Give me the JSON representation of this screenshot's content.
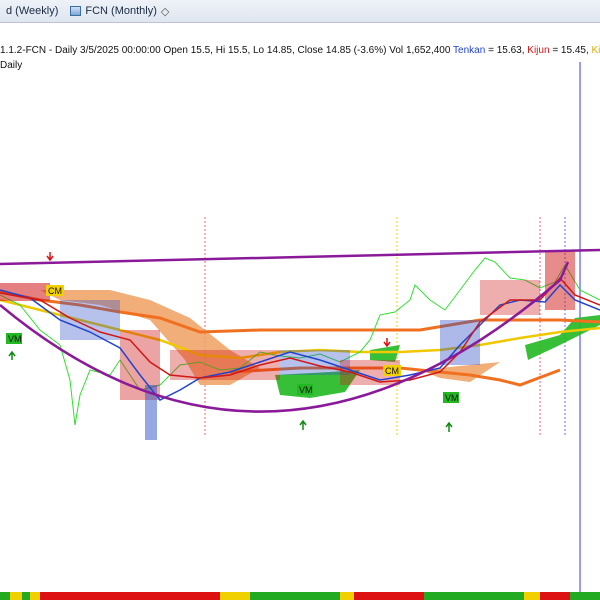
{
  "tabs": [
    {
      "label": "d (Weekly)"
    },
    {
      "label": "FCN (Monthly)"
    }
  ],
  "pin_glyph": "◇",
  "info": {
    "series_id": "1.1.2-FCN",
    "period": "Daily",
    "datetime": "3/5/2025 00:00:00",
    "open_label": "Open",
    "open": "15.5",
    "high_label": "Hi",
    "high": "15.5",
    "low_label": "Lo",
    "low": "14.85",
    "close_label": "Close",
    "close": "14.85",
    "change": "(-3.6%)",
    "vol_label": "Vol",
    "vol": "1,652,400",
    "tenkan_label": "Tenkan",
    "tenkan": "= 15.63,",
    "kijun_label": "Kijun",
    "kijun": "= 15.45,",
    "kijun_cut": "Kiju"
  },
  "period_label": "Daily",
  "markers": [
    {
      "text": "CM"
    },
    {
      "text": "CM"
    },
    {
      "text": "VM"
    },
    {
      "text": "VM"
    },
    {
      "text": "VM"
    }
  ],
  "colors": {
    "tenkan": "#2244cc",
    "kijun": "#d01818",
    "chikou": "#33dd33",
    "ma_orange": "#f07020",
    "ma_yellow": "#f0c800",
    "ma_purple": "#8a1a99",
    "cloud_bull": "#22b822",
    "cloud_bear": "#f0a060",
    "cursor": "#6a6aff"
  },
  "chart_data": {
    "type": "line",
    "series": [
      {
        "name": "Tenkan",
        "values": [
          15.6,
          15.2,
          14.6,
          14.3,
          13.8,
          13.9,
          13.4,
          13.6,
          13.7,
          13.3,
          13.6,
          13.5,
          13.8,
          14.2,
          14.5,
          15.0,
          15.4,
          15.8,
          15.5,
          15.63
        ]
      },
      {
        "name": "Kijun",
        "values": [
          15.5,
          15.3,
          15.0,
          14.4,
          14.0,
          13.8,
          13.6,
          13.7,
          13.8,
          13.5,
          13.6,
          13.6,
          13.7,
          13.9,
          14.3,
          14.7,
          15.0,
          15.4,
          15.5,
          15.45
        ]
      }
    ],
    "ohlc_last": {
      "open": 15.5,
      "high": 15.5,
      "low": 14.85,
      "close": 14.85,
      "volume": 1652400
    }
  },
  "color_strip": [
    {
      "color": "#22aa22",
      "w": 10
    },
    {
      "color": "#f0d000",
      "w": 12
    },
    {
      "color": "#22aa22",
      "w": 8
    },
    {
      "color": "#f0d000",
      "w": 10
    },
    {
      "color": "#dd1111",
      "w": 180
    },
    {
      "color": "#f0d000",
      "w": 30
    },
    {
      "color": "#22aa22",
      "w": 90
    },
    {
      "color": "#f0d000",
      "w": 14
    },
    {
      "color": "#dd1111",
      "w": 70
    },
    {
      "color": "#22aa22",
      "w": 100
    },
    {
      "color": "#f0d000",
      "w": 16
    },
    {
      "color": "#dd1111",
      "w": 30
    },
    {
      "color": "#22aa22",
      "w": 30
    }
  ]
}
